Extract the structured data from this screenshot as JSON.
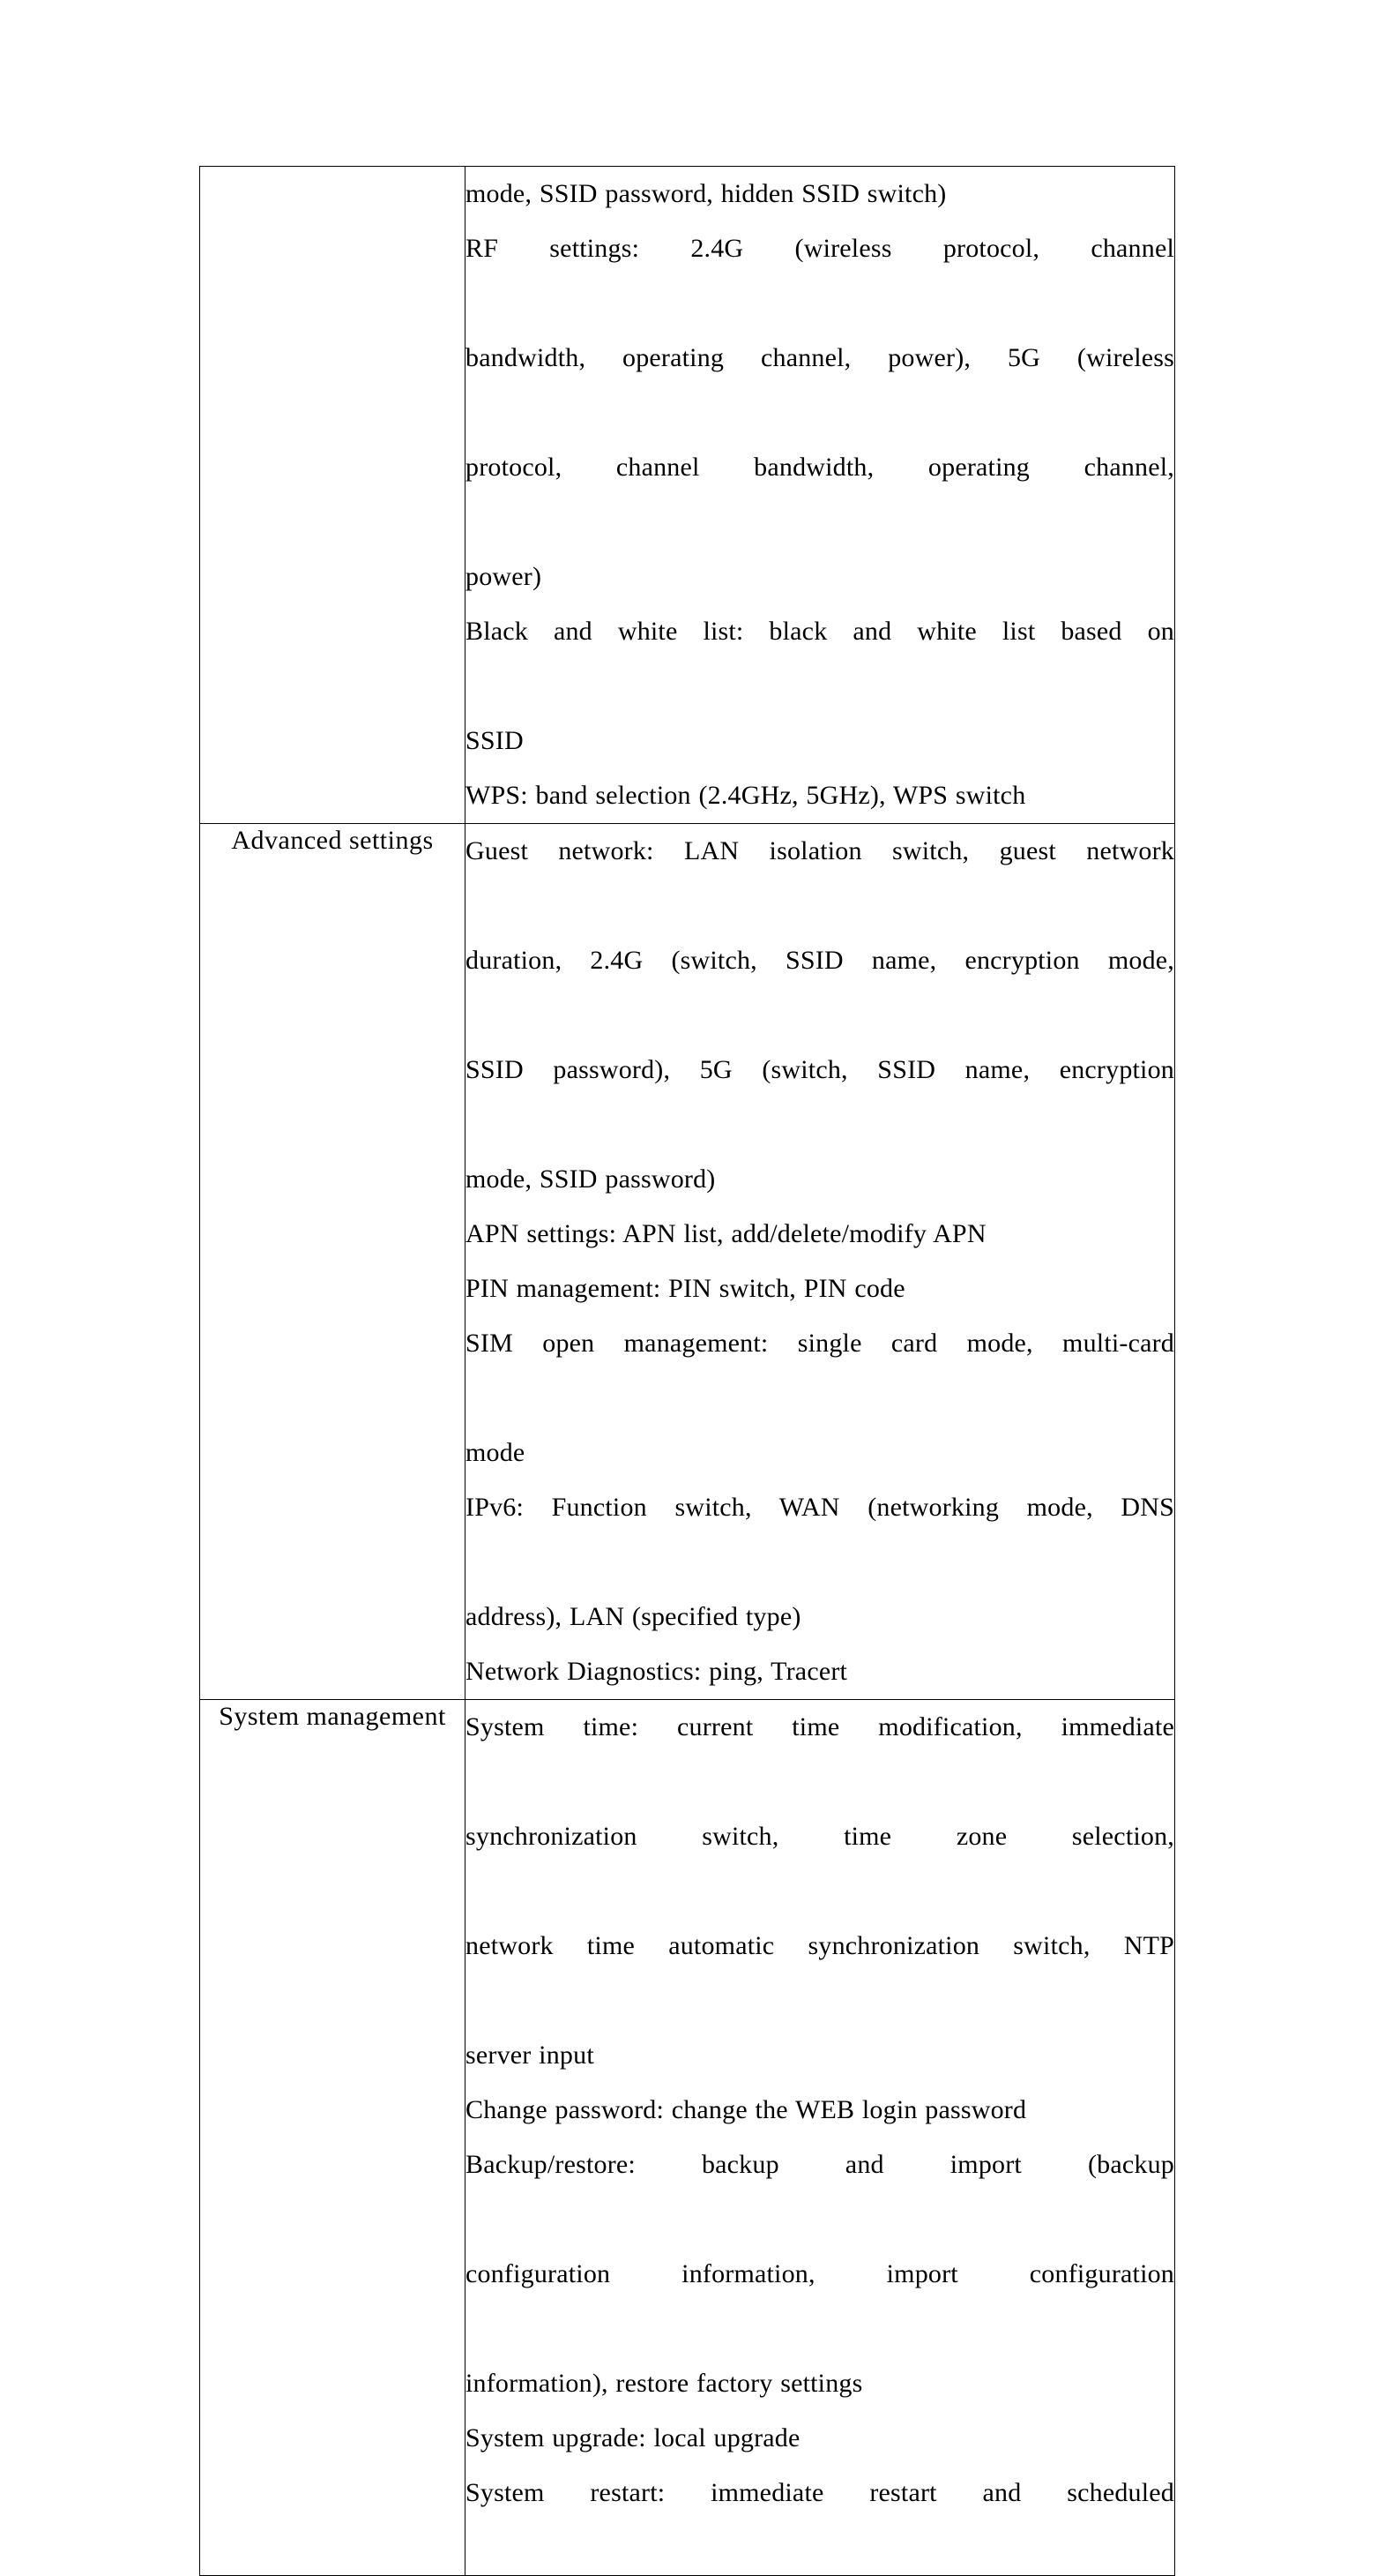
{
  "document": {
    "type": "specification-table",
    "page_background": "#ffffff",
    "text_color": "#000000",
    "border_color": "#000000"
  },
  "table": {
    "columns": [
      "category",
      "description"
    ],
    "rows": [
      {
        "category": "",
        "category_visible": false,
        "continued_from_previous_page": true,
        "paragraphs": [
          {
            "id": "wifi-basic-continued",
            "lines": [
              "mode, SSID password, hidden SSID switch)"
            ],
            "justify_last_line": false
          },
          {
            "id": "rf-settings",
            "lines": [
              "RF settings: 2.4G (wireless protocol, channel",
              "bandwidth, operating channel, power), 5G (wireless",
              "protocol, channel bandwidth, operating channel,",
              "power)"
            ],
            "justify_last_line": false
          },
          {
            "id": "black-and-white-list",
            "lines": [
              "Black and white list: black and white list based on",
              "SSID"
            ],
            "justify_last_line": false
          },
          {
            "id": "wps",
            "lines": [
              "WPS: band selection (2.4GHz, 5GHz), WPS switch"
            ],
            "justify_last_line": false
          }
        ]
      },
      {
        "category": "Advanced settings",
        "category_visible": true,
        "continued_from_previous_page": false,
        "paragraphs": [
          {
            "id": "guest-network",
            "lines": [
              "Guest network: LAN isolation switch, guest network",
              "duration, 2.4G (switch, SSID name, encryption mode,",
              "SSID password), 5G (switch, SSID name, encryption",
              "mode, SSID password)"
            ],
            "justify_last_line": false
          },
          {
            "id": "apn-settings",
            "lines": [
              "APN settings: APN list, add/delete/modify APN"
            ],
            "justify_last_line": false
          },
          {
            "id": "pin-management",
            "lines": [
              "PIN management: PIN switch, PIN code"
            ],
            "justify_last_line": false
          },
          {
            "id": "sim-open-management",
            "lines": [
              "SIM open management: single card mode, multi-card",
              "mode"
            ],
            "justify_last_line": false
          },
          {
            "id": "ipv6",
            "lines": [
              "IPv6: Function switch, WAN (networking mode, DNS",
              "address), LAN (specified type)"
            ],
            "justify_last_line": false
          },
          {
            "id": "network-diagnostics",
            "lines": [
              "Network Diagnostics: ping, Tracert"
            ],
            "justify_last_line": false
          }
        ]
      },
      {
        "category": "System management",
        "category_visible": true,
        "continued_from_previous_page": false,
        "paragraphs": [
          {
            "id": "system-time",
            "lines": [
              "System time: current time modification, immediate",
              "synchronization switch, time zone selection,",
              "network time automatic synchronization switch, NTP",
              "server input"
            ],
            "justify_last_line": false
          },
          {
            "id": "change-password",
            "lines": [
              "Change password: change the WEB login password"
            ],
            "justify_last_line": false
          },
          {
            "id": "backup-restore",
            "lines": [
              "Backup/restore: backup and import (backup",
              "configuration information, import configuration",
              "information), restore factory settings"
            ],
            "justify_last_line": false
          },
          {
            "id": "system-upgrade",
            "lines": [
              "System upgrade: local upgrade"
            ],
            "justify_last_line": false
          },
          {
            "id": "system-restart",
            "lines": [
              "System restart: immediate restart and scheduled"
            ],
            "justify_last_line": false
          }
        ]
      }
    ]
  }
}
